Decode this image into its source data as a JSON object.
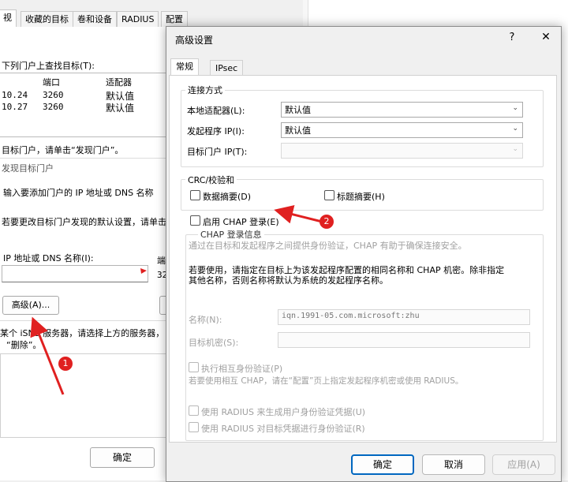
{
  "background_window": {
    "tabs": [
      "视",
      "收藏的目标",
      "卷和设备",
      "RADIUS",
      "配置"
    ],
    "target_list_label": "下列门户上查找目标(T):",
    "columns": [
      "端口",
      "适配器"
    ],
    "rows": [
      {
        "addr": "10.24",
        "port": "3260",
        "adapter": "默认值"
      },
      {
        "addr": "10.27",
        "port": "3260",
        "adapter": "默认值"
      }
    ],
    "discover_hint": "目标门户，请单击“发现门户”。",
    "discover_section": "发现目标门户",
    "enter_ip_hint": "输入要添加门户的 IP 地址或 DNS 名称",
    "change_defaults_hint": "若要更改目标门户发现的默认设置，请单击",
    "ip_field_label": "IP 地址或 DNS 名称(I):",
    "port_label_partial": "端",
    "port_value_partial": "32",
    "advanced_button": "高级(A)...",
    "isns_hint_1": "某个 iSNS 服务器，请选择上方的服务器，",
    "isns_hint_2": "“删除”。",
    "ok_button": "确定"
  },
  "dialog": {
    "title": "高级设置",
    "help": "?",
    "close": "✕",
    "tabs": [
      "常规",
      "IPsec"
    ],
    "connect_group": "连接方式",
    "local_adapter_label": "本地适配器(L):",
    "local_adapter_value": "默认值",
    "initiator_ip_label": "发起程序 IP(I):",
    "initiator_ip_value": "默认值",
    "target_portal_label": "目标门户 IP(T):",
    "target_portal_value": "",
    "crc_group": "CRC/校验和",
    "data_digest": "数据摘要(D)",
    "header_digest": "标题摘要(H)",
    "enable_chap": "启用 CHAP 登录(E)",
    "chap_group": "CHAP 登录信息",
    "chap_desc": "通过在目标和发起程序之间提供身份验证，CHAP 有助于确保连接安全。",
    "chap_usage_1": "若要使用，请指定在目标上为该发起程序配置的相同名称和 CHAP 机密。除非指定",
    "chap_usage_2": "其他名称，否则名称将默认为系统的发起程序名称。",
    "name_label": "名称(N):",
    "name_value": "iqn.1991-05.com.microsoft:zhu",
    "secret_label": "目标机密(S):",
    "mutual_auth": "执行相互身份验证(P)",
    "mutual_hint": "若要使用相互 CHAP，请在“配置”页上指定发起程序机密或使用 RADIUS。",
    "radius_gen": "使用 RADIUS 来生成用户身份验证凭据(U)",
    "radius_auth": "使用 RADIUS 对目标凭据进行身份验证(R)",
    "ok": "确定",
    "cancel": "取消",
    "apply": "应用(A)"
  },
  "annotations": {
    "badge1": "1",
    "badge2": "2"
  },
  "colors": {
    "accent": "#0067c0",
    "annotation": "#e02020"
  }
}
